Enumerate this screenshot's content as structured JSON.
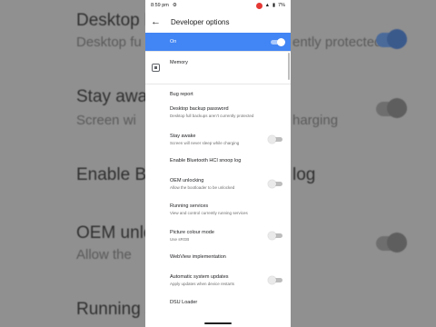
{
  "status_bar": {
    "time": "8:59 pm",
    "battery": "7%"
  },
  "header": {
    "title": "Developer options"
  },
  "master_switch": {
    "label": "On"
  },
  "items": [
    {
      "title": "Memory",
      "subtitle": ""
    },
    {
      "title": "Bug report",
      "subtitle": ""
    },
    {
      "title": "Desktop backup password",
      "subtitle": "Desktop full backups aren't currently protected"
    },
    {
      "title": "Stay awake",
      "subtitle": "Screen will never sleep while charging"
    },
    {
      "title": "Enable Bluetooth HCI snoop log",
      "subtitle": ""
    },
    {
      "title": "OEM unlocking",
      "subtitle": "Allow the bootloader to be unlocked"
    },
    {
      "title": "Running services",
      "subtitle": "View and control currently running services"
    },
    {
      "title": "Picture colour mode",
      "subtitle": "Use sRGB"
    },
    {
      "title": "WebView implementation",
      "subtitle": ""
    },
    {
      "title": "Automatic system updates",
      "subtitle": "Apply updates when device restarts"
    },
    {
      "title": "DSU Loader",
      "subtitle": ""
    }
  ],
  "background": {
    "lines": [
      {
        "text": "Desktop b"
      },
      {
        "text": "Desktop fu"
      },
      {
        "text": "ently protected"
      },
      {
        "text": "Stay awa"
      },
      {
        "text": "Screen wi"
      },
      {
        "text": "harging"
      },
      {
        "text": "Enable Bl"
      },
      {
        "text": "log"
      },
      {
        "text": "OEM unlo"
      },
      {
        "text": "Allow the"
      },
      {
        "text": "Running s"
      }
    ]
  }
}
